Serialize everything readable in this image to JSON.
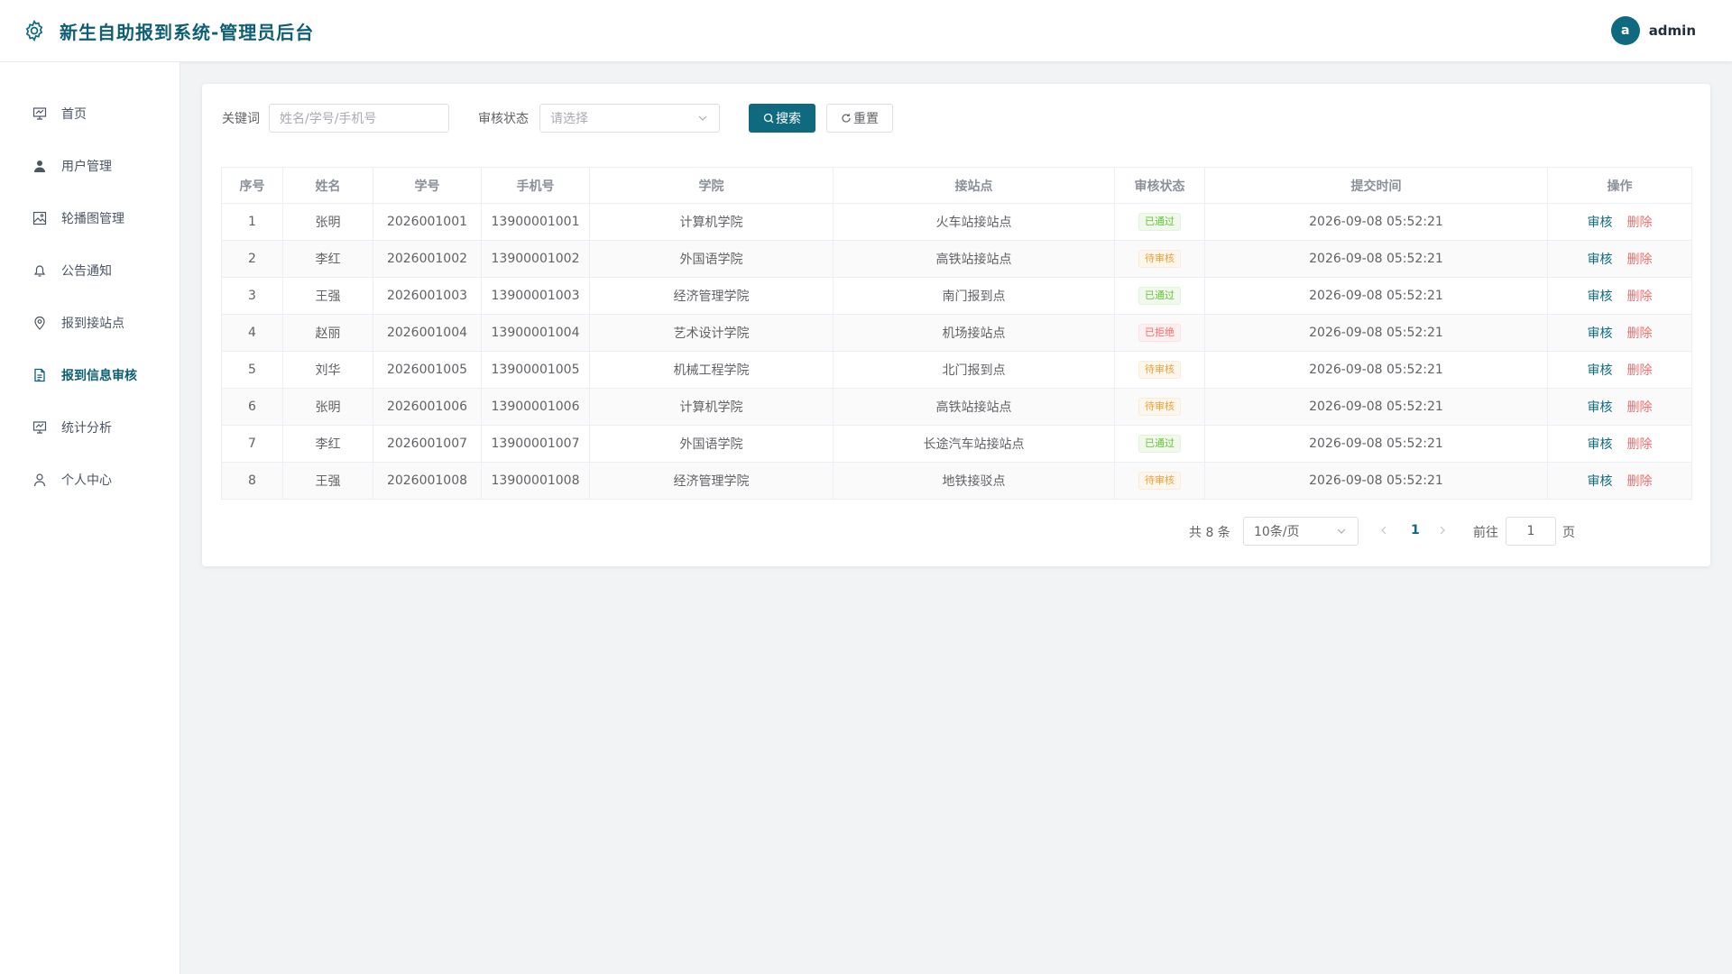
{
  "header": {
    "title": "新生自助报到系统-管理员后台",
    "avatar_letter": "a",
    "username": "admin"
  },
  "sidebar": {
    "items": [
      {
        "label": "首页",
        "icon": "presentation-icon"
      },
      {
        "label": "用户管理",
        "icon": "user-icon"
      },
      {
        "label": "轮播图管理",
        "icon": "image-icon"
      },
      {
        "label": "公告通知",
        "icon": "bell-icon"
      },
      {
        "label": "报到接站点",
        "icon": "location-icon"
      },
      {
        "label": "报到信息审核",
        "icon": "document-icon"
      },
      {
        "label": "统计分析",
        "icon": "presentation-icon"
      },
      {
        "label": "个人中心",
        "icon": "user-outline-icon"
      }
    ],
    "active_index": 5
  },
  "filter": {
    "keyword_label": "关键词",
    "keyword_placeholder": "姓名/学号/手机号",
    "status_label": "审核状态",
    "status_placeholder": "请选择",
    "search_label": "搜索",
    "reset_label": "重置"
  },
  "table": {
    "headers": [
      "序号",
      "姓名",
      "学号",
      "手机号",
      "学院",
      "接站点",
      "审核状态",
      "提交时间",
      "操作"
    ],
    "rows": [
      {
        "no": "1",
        "name": "张明",
        "sid": "2026001001",
        "phone": "13900001001",
        "college": "计算机学院",
        "station": "火车站接站点",
        "status": "已通过",
        "time": "2026-09-08 05:52:21"
      },
      {
        "no": "2",
        "name": "李红",
        "sid": "2026001002",
        "phone": "13900001002",
        "college": "外国语学院",
        "station": "高铁站接站点",
        "status": "待审核",
        "time": "2026-09-08 05:52:21"
      },
      {
        "no": "3",
        "name": "王强",
        "sid": "2026001003",
        "phone": "13900001003",
        "college": "经济管理学院",
        "station": "南门报到点",
        "status": "已通过",
        "time": "2026-09-08 05:52:21"
      },
      {
        "no": "4",
        "name": "赵丽",
        "sid": "2026001004",
        "phone": "13900001004",
        "college": "艺术设计学院",
        "station": "机场接站点",
        "status": "已拒绝",
        "time": "2026-09-08 05:52:21"
      },
      {
        "no": "5",
        "name": "刘华",
        "sid": "2026001005",
        "phone": "13900001005",
        "college": "机械工程学院",
        "station": "北门报到点",
        "status": "待审核",
        "time": "2026-09-08 05:52:21"
      },
      {
        "no": "6",
        "name": "张明",
        "sid": "2026001006",
        "phone": "13900001006",
        "college": "计算机学院",
        "station": "高铁站接站点",
        "status": "待审核",
        "time": "2026-09-08 05:52:21"
      },
      {
        "no": "7",
        "name": "李红",
        "sid": "2026001007",
        "phone": "13900001007",
        "college": "外国语学院",
        "station": "长途汽车站接站点",
        "status": "已通过",
        "time": "2026-09-08 05:52:21"
      },
      {
        "no": "8",
        "name": "王强",
        "sid": "2026001008",
        "phone": "13900001008",
        "college": "经济管理学院",
        "station": "地铁接驳点",
        "status": "待审核",
        "time": "2026-09-08 05:52:21"
      }
    ],
    "audit_label": "审核",
    "delete_label": "删除"
  },
  "pagination": {
    "total_text": "共 8 条",
    "page_size": "10条/页",
    "current_page": "1",
    "goto_label": "前往",
    "goto_value": "1",
    "page_suffix": "页"
  },
  "colors": {
    "primary": "#0f6a80",
    "success": "#67c23a",
    "warning": "#e6a23c",
    "danger": "#f56c6c"
  }
}
